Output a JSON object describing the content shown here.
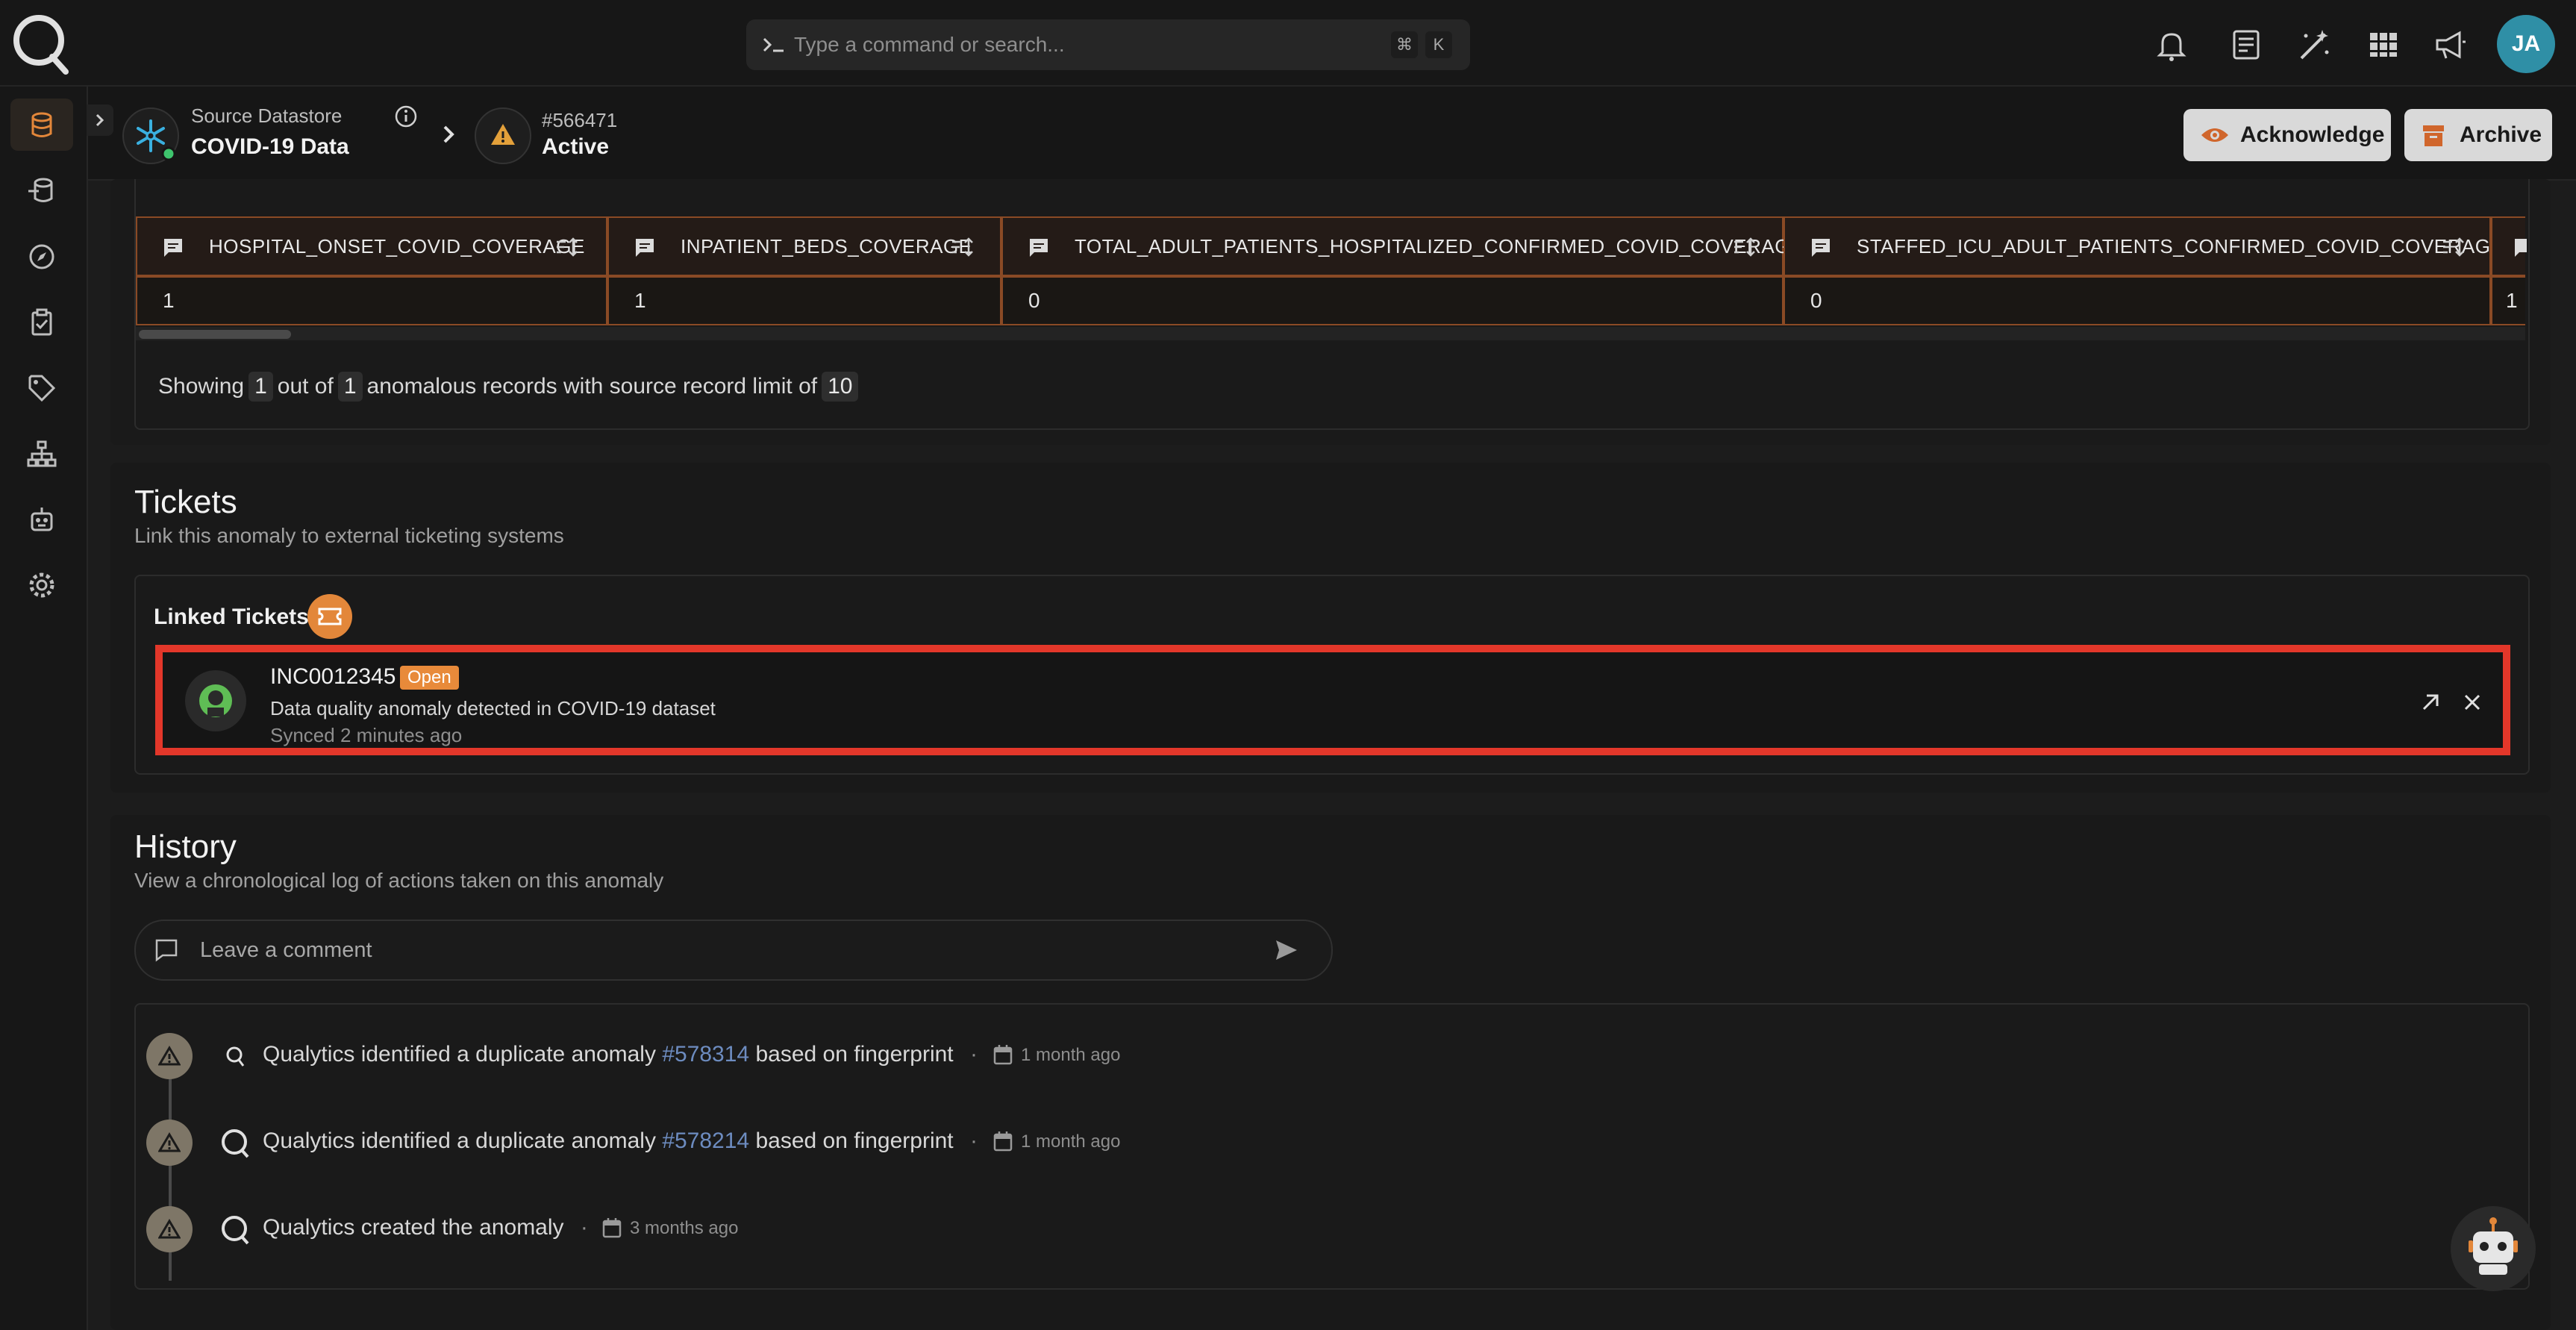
{
  "topbar": {
    "search_placeholder": "Type a command or search...",
    "kbd_cmd": "⌘",
    "kbd_k": "K",
    "avatar_initials": "JA",
    "accent": "#2f8fa6"
  },
  "sidebar": {
    "items": [
      "database-icon",
      "datastore-icon",
      "explore-icon",
      "checks-icon",
      "tags-icon",
      "hierarchy-icon",
      "agent-icon",
      "settings-icon"
    ]
  },
  "header": {
    "source_label": "Source Datastore",
    "source_name": "COVID-19 Data",
    "anomaly_id": "#566471",
    "anomaly_status": "Active",
    "acknowledge_label": "Acknowledge",
    "archive_label": "Archive"
  },
  "records": {
    "columns": [
      "HOSPITAL_ONSET_COVID_COVERAGE",
      "INPATIENT_BEDS_COVERAGE",
      "TOTAL_ADULT_PATIENTS_HOSPITALIZED_CONFIRMED_COVID_COVERAGE",
      "STAFFED_ICU_ADULT_PATIENTS_CONFIRMED_COVID_COVERAGE"
    ],
    "row": [
      "1",
      "1",
      "0",
      "0",
      "1"
    ],
    "showing_prefix": "Showing",
    "showing_count": "1",
    "out_of": "out of",
    "total": "1",
    "suffix": "anomalous records with source record limit of",
    "limit": "10"
  },
  "tickets": {
    "title": "Tickets",
    "subtitle": "Link this anomaly to external ticketing systems",
    "linked_label": "Linked Tickets",
    "ticket": {
      "id": "INC0012345",
      "status": "Open",
      "description": "Data quality anomaly detected in COVID-19 dataset",
      "synced": "Synced 2 minutes ago"
    }
  },
  "history": {
    "title": "History",
    "subtitle": "View a chronological log of actions taken on this anomaly",
    "comment_placeholder": "Leave a comment",
    "events": [
      {
        "pre": "Qualytics identified a duplicate anomaly",
        "link": "#578314",
        "post": "based on fingerprint",
        "time": "1 month ago"
      },
      {
        "pre": "Qualytics identified a duplicate anomaly",
        "link": "#578214",
        "post": "based on fingerprint",
        "time": "1 month ago"
      },
      {
        "pre": "Qualytics created the anomaly",
        "link": "",
        "post": "",
        "time": "3 months ago"
      }
    ]
  }
}
